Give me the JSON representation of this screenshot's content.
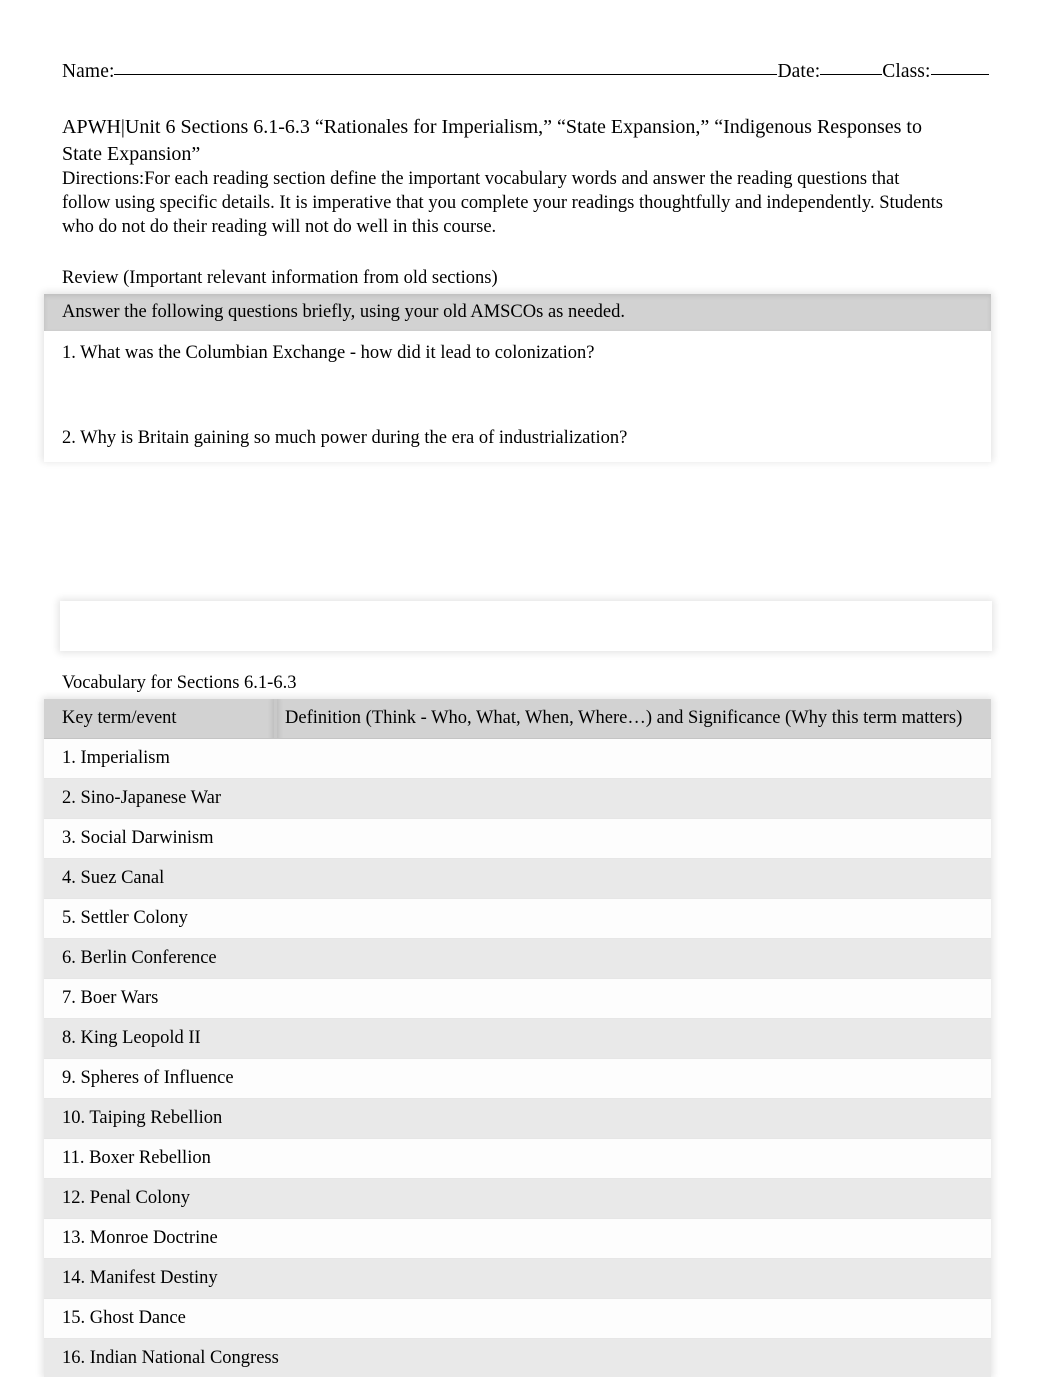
{
  "header": {
    "name_label": "Name:",
    "date_label": "Date:",
    "class_label": "Class:"
  },
  "title": "APWH|Unit 6 Sections 6.1-6.3 “Rationales for Imperialism,” “State Expansion,” “Indigenous Responses to State Expansion”",
  "directions_label": "Directions:",
  "directions_text": "For each reading section define the important vocabulary words and answer the reading questions that follow using specific details. It is imperative that you complete your readings thoughtfully and independently. Students who do not do their reading will not do well in this course.",
  "review": {
    "caption": "Review (Important relevant information from old sections)",
    "instruction": "Answer the following questions briefly, using your old AMSCOs as needed.",
    "questions": [
      "1. What was the Columbian Exchange - how did it lead to colonization?",
      "2. Why is Britain gaining so much power during the era of industrialization?"
    ]
  },
  "vocabulary": {
    "caption": "Vocabulary for Sections 6.1-6.3",
    "columns": {
      "term": "Key term/event",
      "definition": "Definition (Think - Who, What, When, Where…) and Significance (Why this term matters)"
    },
    "rows": [
      {
        "term": "1. Imperialism",
        "definition": ""
      },
      {
        "term": "2. Sino-Japanese War",
        "definition": ""
      },
      {
        "term": "3. Social Darwinism",
        "definition": ""
      },
      {
        "term": "4. Suez Canal",
        "definition": ""
      },
      {
        "term": "5. Settler Colony",
        "definition": ""
      },
      {
        "term": "6. Berlin Conference",
        "definition": ""
      },
      {
        "term": "7. Boer Wars",
        "definition": ""
      },
      {
        "term": "8. King Leopold II",
        "definition": ""
      },
      {
        "term": "9. Spheres of Influence",
        "definition": ""
      },
      {
        "term": "10. Taiping Rebellion",
        "definition": ""
      },
      {
        "term": "11. Boxer Rebellion",
        "definition": ""
      },
      {
        "term": "12. Penal Colony",
        "definition": ""
      },
      {
        "term": "13. Monroe Doctrine",
        "definition": ""
      },
      {
        "term": "14. Manifest Destiny",
        "definition": ""
      },
      {
        "term": "15. Ghost Dance",
        "definition": ""
      },
      {
        "term": "16. Indian National Congress",
        "definition": ""
      }
    ]
  },
  "colors": {
    "header_band": "#d2d2d2",
    "row_shade": "#e9e9e9",
    "page_background": "#ffffff",
    "text": "#000000"
  }
}
